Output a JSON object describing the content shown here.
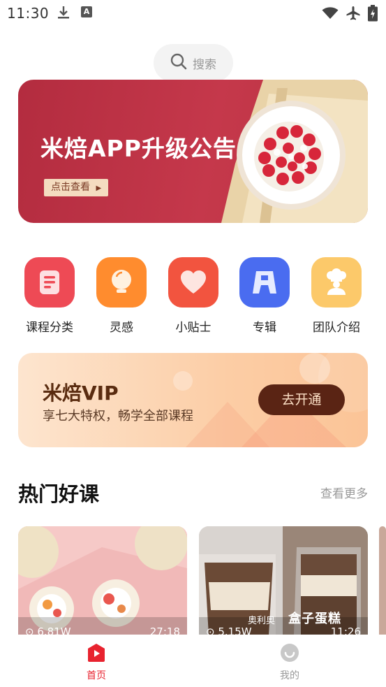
{
  "status_bar": {
    "time": "11:30"
  },
  "search": {
    "label": "搜索"
  },
  "banner": {
    "title": "米焙APP升级公告",
    "button_label": "点击查看"
  },
  "categories": [
    {
      "label": "课程分类",
      "color": "#ee4a55",
      "icon": "document-icon"
    },
    {
      "label": "灵感",
      "color": "#ff8c2e",
      "icon": "lightbulb-icon"
    },
    {
      "label": "小贴士",
      "color": "#f2543f",
      "icon": "heart-icon"
    },
    {
      "label": "专辑",
      "color": "#4a6cf0",
      "icon": "album-icon"
    },
    {
      "label": "团队介绍",
      "color": "#fcc96a",
      "icon": "chef-icon"
    }
  ],
  "vip": {
    "title": "米焙VIP",
    "subtitle": "享七大特权，畅学全部课程",
    "button_label": "去开通"
  },
  "section": {
    "title": "热门好课",
    "more_label": "查看更多"
  },
  "cards": [
    {
      "views": "6.81W",
      "duration": "27:18"
    },
    {
      "views": "5.15W",
      "duration": "11:26",
      "overlay_brand": "奥利奥",
      "overlay_title": "盒子蛋糕"
    }
  ],
  "tabbar": [
    {
      "label": "首页",
      "active": true
    },
    {
      "label": "我的",
      "active": false
    }
  ],
  "colors": {
    "accent": "#e8232f",
    "banner_bg": "#b8303f",
    "vip_button": "#5a2414"
  }
}
